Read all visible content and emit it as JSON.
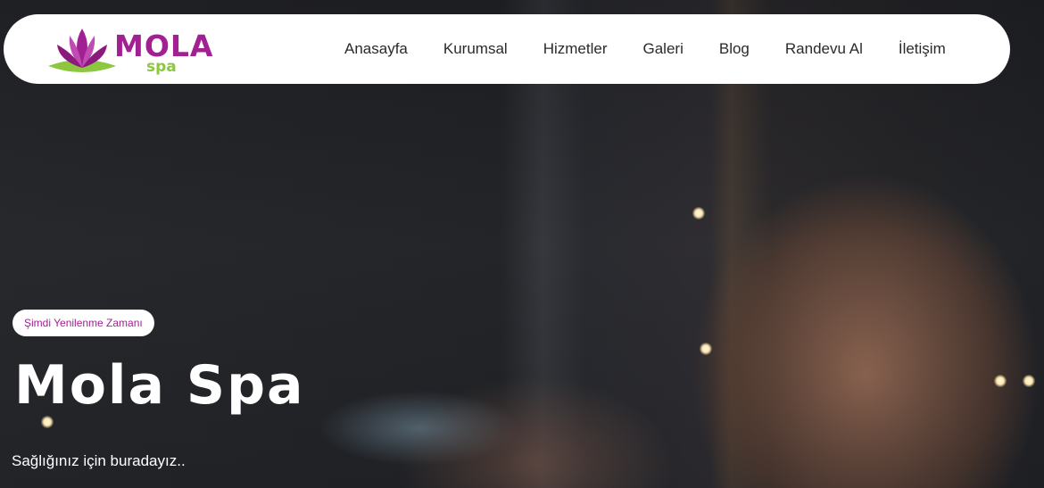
{
  "brand": {
    "name": "MOLA",
    "sub": "spa",
    "primary_color": "#a22192",
    "secondary_color": "#8dc63f"
  },
  "nav": {
    "items": [
      {
        "label": "Anasayfa"
      },
      {
        "label": "Kurumsal"
      },
      {
        "label": "Hizmetler"
      },
      {
        "label": "Galeri"
      },
      {
        "label": "Blog"
      },
      {
        "label": "Randevu Al"
      },
      {
        "label": "İletişim"
      }
    ]
  },
  "hero": {
    "tagline": "Şimdi Yenilenme Zamanı",
    "title": "Mola Spa",
    "subtitle": "Sağlığınız için buradayız.."
  }
}
